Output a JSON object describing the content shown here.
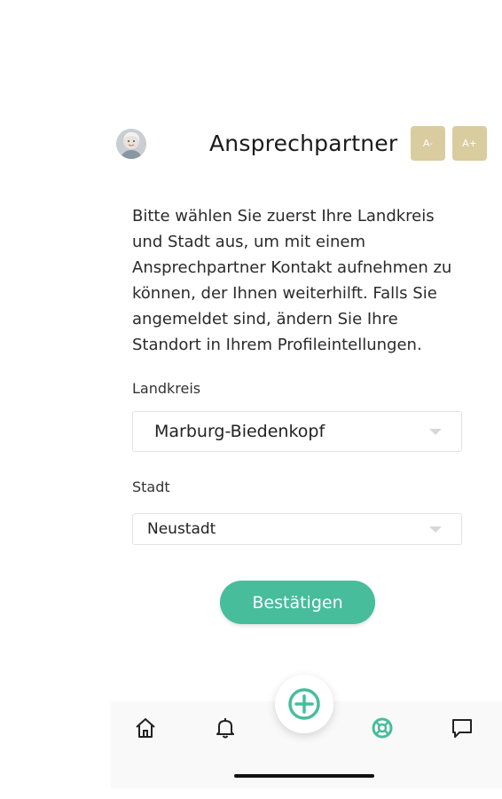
{
  "header": {
    "title": "Ansprechpartner",
    "font_decrease_label": "A-",
    "font_increase_label": "A+"
  },
  "intro_text": "Bitte wählen Sie zuerst Ihre Landkreis und Stadt aus, um mit einem Ansprechpartner Kontakt aufnehmen zu können, der Ihnen weiterhilft. Falls Sie angemeldet sind, ändern Sie Ihre Standort in Ihrem Profileintellungen.",
  "form": {
    "landkreis": {
      "label": "Landkreis",
      "value": "Marburg-Biedenkopf"
    },
    "stadt": {
      "label": "Stadt",
      "value": "Neustadt"
    },
    "confirm_label": "Bestätigen"
  },
  "bottom_nav": {
    "items": [
      {
        "icon": "home-icon"
      },
      {
        "icon": "bell-icon"
      },
      {
        "icon": "plus-circle-icon"
      },
      {
        "icon": "lifebuoy-icon",
        "active": true
      },
      {
        "icon": "chat-icon"
      }
    ]
  },
  "colors": {
    "accent": "#47bd9b",
    "font_button": "#d9cc9f",
    "nav_icon": "#222222"
  }
}
